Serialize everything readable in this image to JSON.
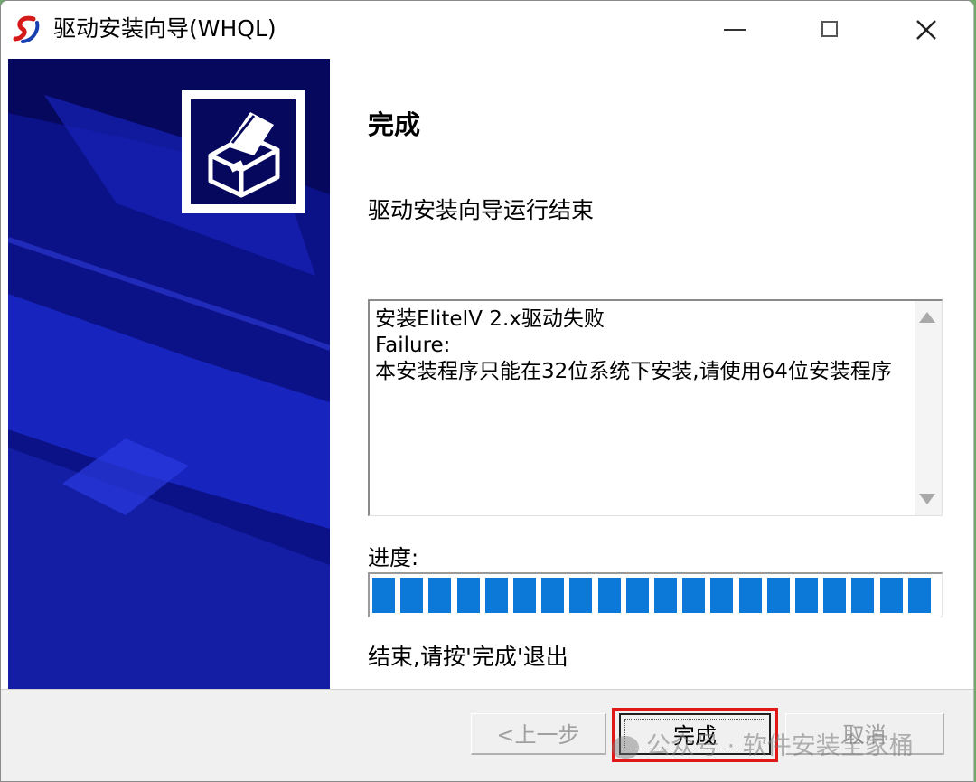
{
  "window": {
    "title": "驱动安装向导(WHQL)",
    "icons": {
      "app": "app-logo-icon",
      "minimize": "minimize-icon",
      "maximize": "maximize-icon",
      "close": "close-icon"
    }
  },
  "wizard": {
    "heading": "完成",
    "subtitle": "驱动安装向导运行结束",
    "log_text": "安装EliteIV 2.x驱动失败\nFailure:\n本安装程序只能在32位系统下安装,请使用64位安装程序",
    "progress_label": "进度:",
    "progress_value": 1.0,
    "finish_message": "结束,请按'完成'退出",
    "banner_icon": "printer-icon"
  },
  "buttons": {
    "prev": "<上一步",
    "finish": "完成",
    "cancel": "取消"
  },
  "overlay": {
    "watermark": "公众号 · 软件安装全家桶"
  },
  "colors": {
    "banner_bg": "#06085e",
    "progress_fill": "#0c78d8",
    "highlight_border": "#e01818"
  }
}
